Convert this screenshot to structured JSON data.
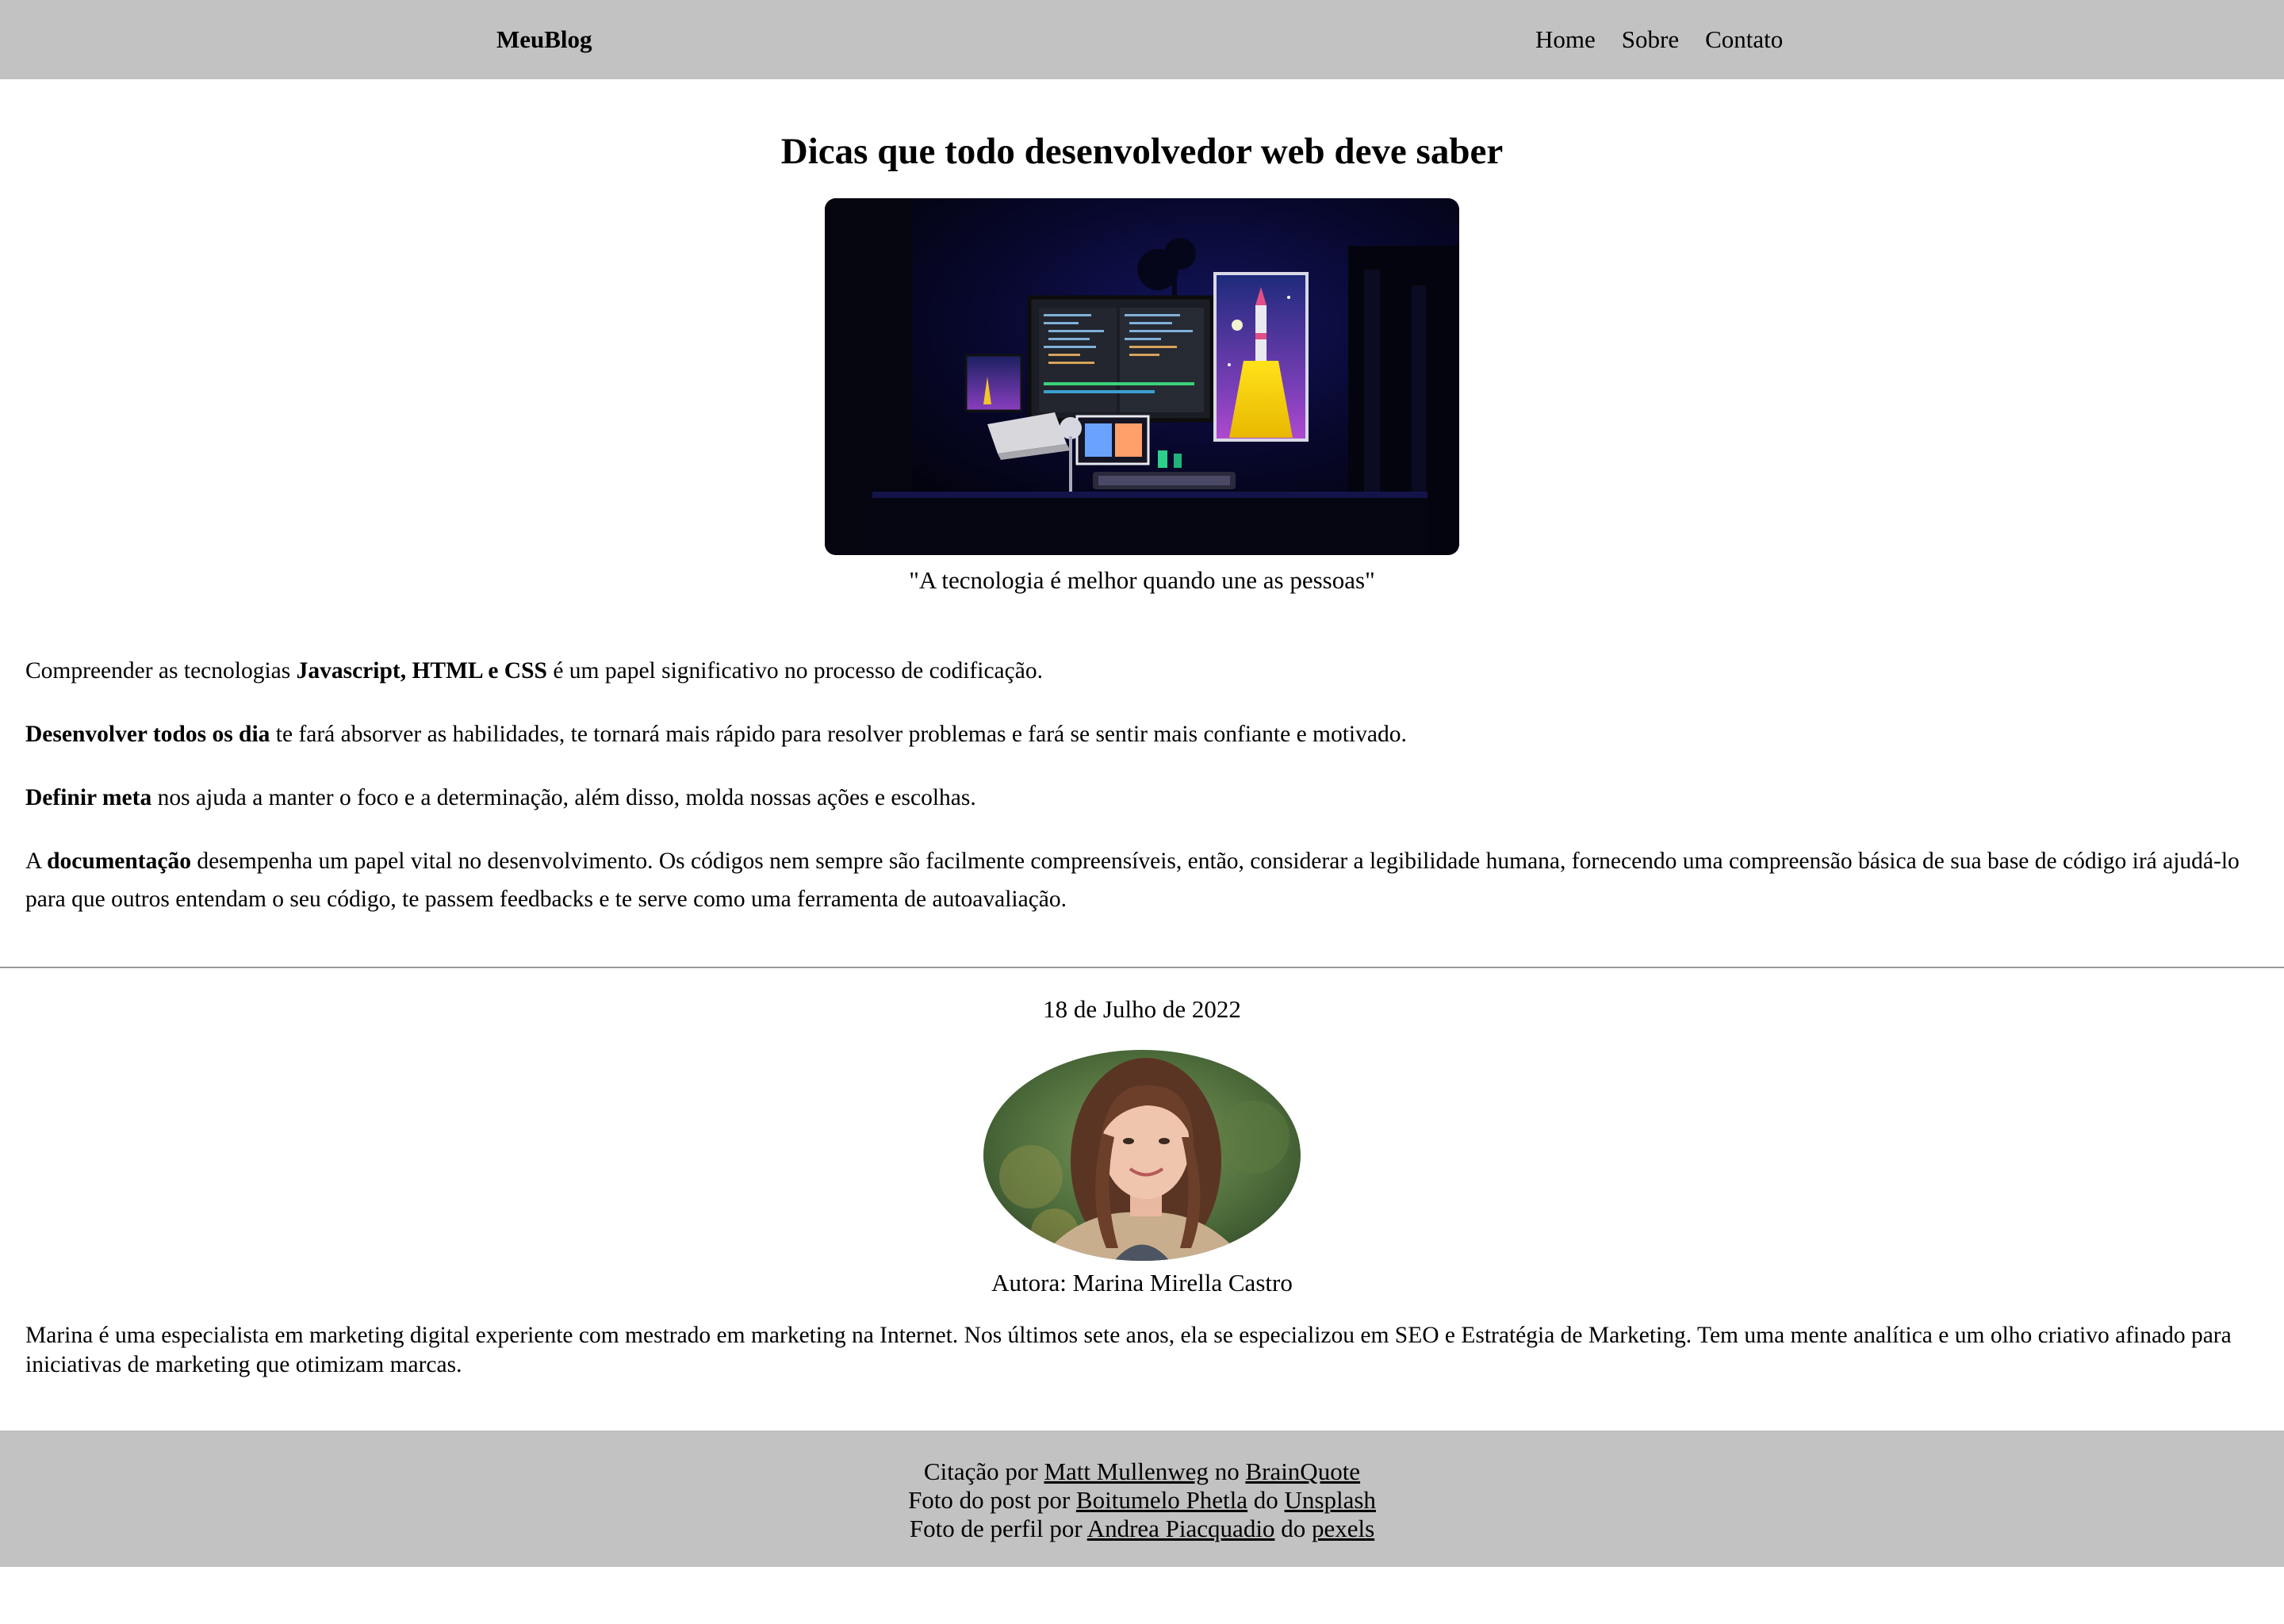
{
  "header": {
    "brand": "MeuBlog",
    "nav": [
      "Home",
      "Sobre",
      "Contato"
    ]
  },
  "post": {
    "title": "Dicas que todo desenvolvedor web deve saber",
    "hero_icon": "developer-desk-photo",
    "quote": "\"A tecnologia é melhor quando une as pessoas\"",
    "paragraphs": [
      {
        "before": "Compreender as tecnologias ",
        "bold": "Javascript, HTML e CSS",
        "after": " é um papel significativo no processo de codificação."
      },
      {
        "before": "",
        "bold": "Desenvolver todos os dia",
        "after": " te fará absorver as habilidades, te tornará mais rápido para resolver problemas e fará se sentir mais confiante e motivado."
      },
      {
        "before": "",
        "bold": "Definir meta",
        "after": " nos ajuda a manter o foco e a determinação, além disso, molda nossas ações e escolhas."
      },
      {
        "before": "A ",
        "bold": "documentação",
        "after": " desempenha um papel vital no desenvolvimento. Os códigos nem sempre são facilmente compreensíveis, então, considerar a legibilidade humana, fornecendo uma compreensão básica de sua base de código irá ajudá-lo para que outros entendam o seu código, te passem feedbacks e te serve como uma ferramenta de autoavaliação."
      }
    ],
    "date": "18 de Julho de 2022",
    "avatar_icon": "author-portrait-photo",
    "author": "Autora: Marina Mirella Castro",
    "bio": "Marina é uma especialista em marketing digital experiente com mestrado em marketing na Internet. Nos últimos sete anos, ela se especializou em SEO e Estratégia de Marketing. Tem uma mente analítica e um olho criativo afinado para iniciativas de marketing que otimizam marcas."
  },
  "footer": {
    "credits": [
      {
        "prefix": "Citação por ",
        "person": "Matt Mullenweg",
        "middle": " no ",
        "source": "BrainQuote"
      },
      {
        "prefix": "Foto do post por ",
        "person": "Boitumelo Phetla",
        "middle": " do ",
        "source": "Unsplash"
      },
      {
        "prefix": "Foto de perfil por ",
        "person": "Andrea Piacquadio",
        "middle": " do ",
        "source": "pexels"
      }
    ]
  },
  "colors": {
    "header_bg": "#c2c2c2",
    "footer_bg": "#c2c2c2",
    "text": "#000000",
    "divider": "#9a9a9a"
  }
}
